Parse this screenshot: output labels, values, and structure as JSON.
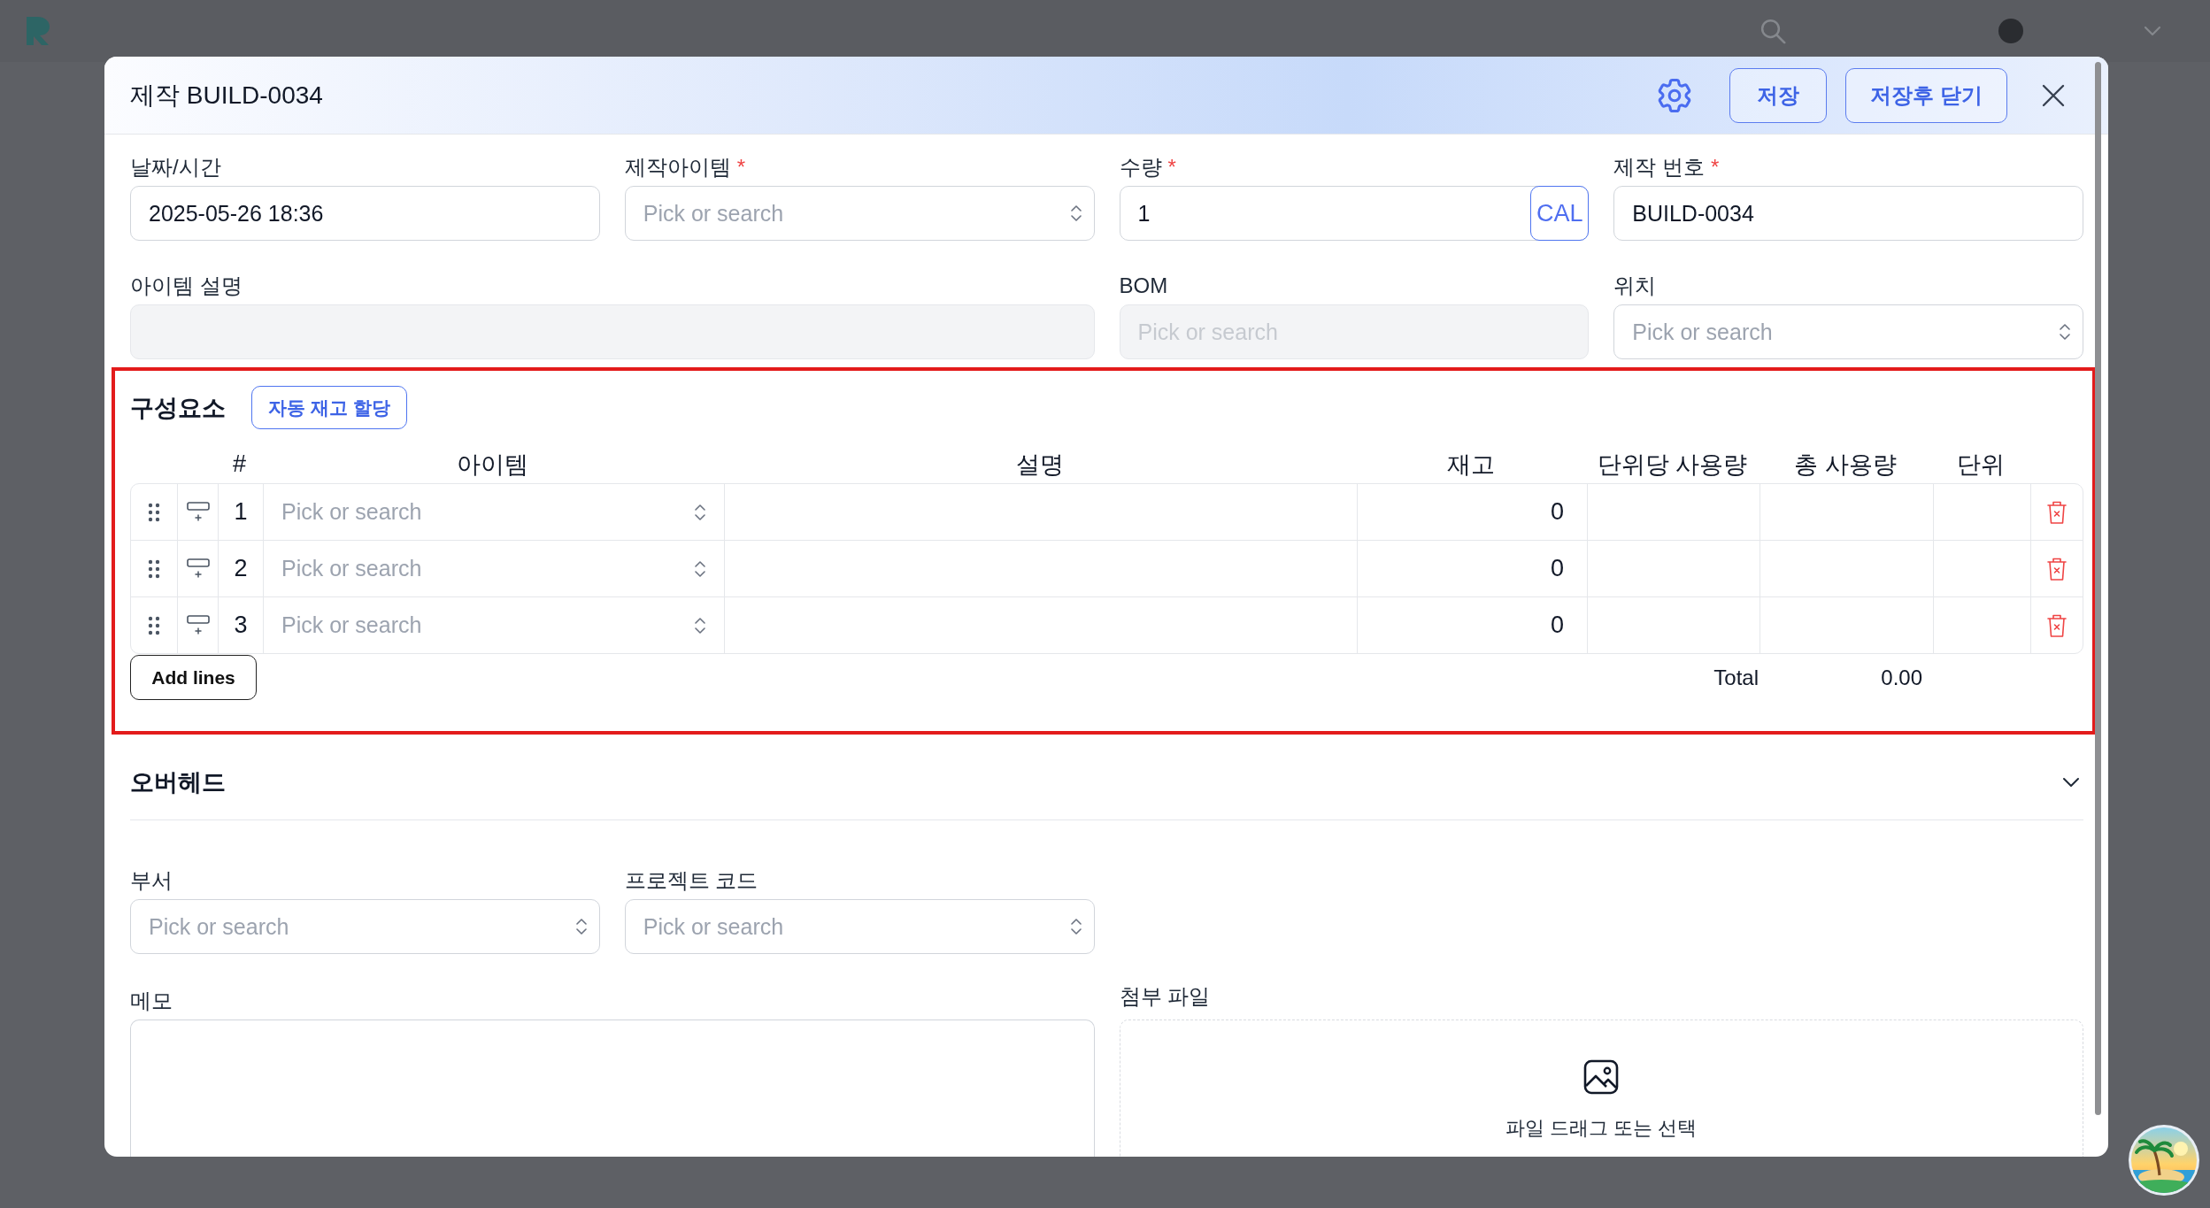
{
  "dialog": {
    "title": "제작 BUILD-0034",
    "buttons": [
      {
        "kind": "save",
        "label": "저장"
      },
      {
        "kind": "save_close",
        "label": "저장후 닫기"
      }
    ]
  },
  "main_fields": [
    {
      "kind": "text",
      "label": "날짜/시간",
      "disabled": false,
      "value": "2025-05-26 18:36"
    },
    {
      "kind": "select",
      "label": "제작아이템",
      "required_mark": "*",
      "disabled": false,
      "placeholder": "Pick or search"
    },
    {
      "kind": "calc",
      "label": "수량",
      "required_mark": "*",
      "disabled": false,
      "value": "1",
      "button": "CAL"
    },
    {
      "kind": "text",
      "label": "제작 번호",
      "required_mark": "*",
      "disabled": false,
      "value": "BUILD-0034"
    },
    {
      "kind": "description",
      "label": "아이템 설명",
      "disabled": true
    },
    {
      "kind": "select",
      "label": "BOM",
      "disabled": true,
      "placeholder": "Pick or search"
    },
    {
      "kind": "select",
      "label": "위치",
      "disabled": false,
      "placeholder": "Pick or search"
    }
  ],
  "components": {
    "highlighted": true,
    "title": "구성요소",
    "auto_allocate_button": "자동 재고 할당",
    "columns": [
      "#",
      "아이템",
      "설명",
      "재고",
      "단위당 사용량",
      "총 사용량",
      "단위"
    ],
    "rows": [
      {
        "number": "1",
        "item_placeholder": "Pick or search",
        "stock": "0"
      },
      {
        "number": "2",
        "item_placeholder": "Pick or search",
        "stock": "0"
      },
      {
        "number": "3",
        "item_placeholder": "Pick or search",
        "stock": "0"
      }
    ],
    "add_lines_button": "Add lines",
    "total_label": "Total",
    "total_value": "0.00"
  },
  "overhead": {
    "title": "오버헤드"
  },
  "extra_fields": [
    {
      "kind": "select",
      "label": "부서",
      "disabled": false,
      "placeholder": "Pick or search"
    },
    {
      "kind": "select",
      "label": "프로젝트 코드",
      "disabled": false,
      "placeholder": "Pick or search"
    }
  ],
  "memo": {
    "label": "메모"
  },
  "attachments": {
    "label": "첨부 파일",
    "prompt": "파일 드래그 또는 선택"
  }
}
